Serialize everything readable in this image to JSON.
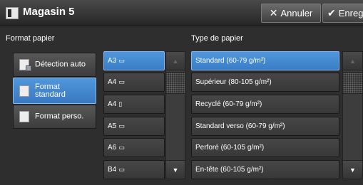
{
  "header": {
    "title": "Magasin 5",
    "cancel_label": "Annuler",
    "save_label": "Enregistrer"
  },
  "paper_format": {
    "section_label": "Format papier",
    "buttons": [
      {
        "label": "Détection auto",
        "selected": false
      },
      {
        "label": "Format standard",
        "selected": true
      },
      {
        "label": "Format perso.",
        "selected": false
      }
    ]
  },
  "paper_sizes": {
    "items": [
      {
        "label": "A3",
        "orientation": "landscape",
        "selected": true
      },
      {
        "label": "A4",
        "orientation": "landscape",
        "selected": false
      },
      {
        "label": "A4",
        "orientation": "portrait",
        "selected": false
      },
      {
        "label": "A5",
        "orientation": "landscape",
        "selected": false
      },
      {
        "label": "A6",
        "orientation": "landscape",
        "selected": false
      },
      {
        "label": "B4",
        "orientation": "landscape",
        "selected": false
      }
    ]
  },
  "paper_type": {
    "section_label": "Type de papier",
    "items": [
      {
        "label": "Standard (60-79 g/m²)",
        "selected": true
      },
      {
        "label": "Supérieur (80-105 g/m²)",
        "selected": false
      },
      {
        "label": "Recyclé (60-79 g/m²)",
        "selected": false
      },
      {
        "label": "Standard verso (60-79 g/m²)",
        "selected": false
      },
      {
        "label": "Perforé (60-105 g/m²)",
        "selected": false
      },
      {
        "label": "En-tête (60-105 g/m²)",
        "selected": false
      }
    ]
  },
  "icons": {
    "tray": "tray-icon",
    "cancel": "x-icon",
    "save": "checkmark-icon",
    "scroll_up": "triangle-up-icon",
    "scroll_down": "triangle-down-icon",
    "landscape": "landscape-sheet-icon",
    "portrait": "portrait-sheet-icon"
  },
  "colors": {
    "selected": "#3d83cd",
    "background": "#2e2e2e"
  }
}
